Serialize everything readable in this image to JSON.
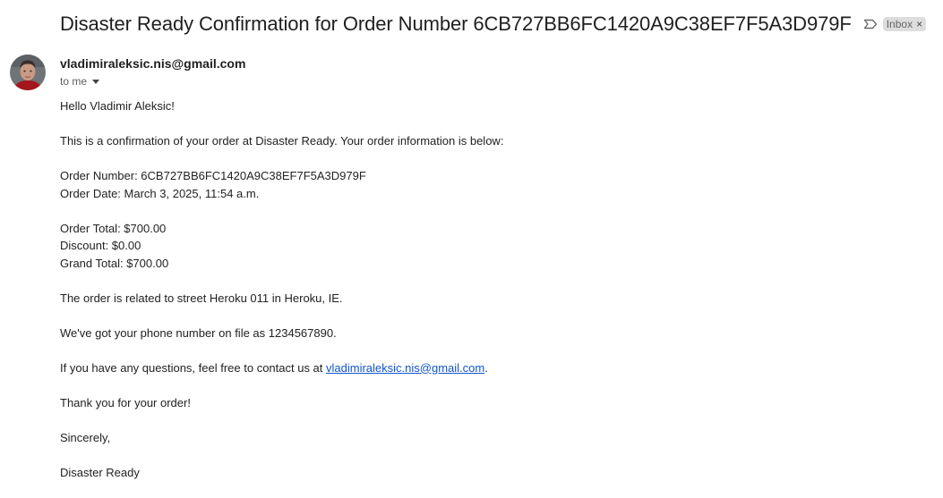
{
  "email": {
    "subject": "Disaster Ready Confirmation for Order Number 6CB727BB6FC1420A9C38EF7F5A3D979F",
    "label": "Inbox",
    "label_close": "×",
    "sender": "vladimiraleksic.nis@gmail.com",
    "recipient": "to me",
    "avatar_icon": "sender-avatar",
    "important_icon": "importance-marker-icon"
  },
  "body": {
    "greeting": "Hello Vladimir Aleksic!",
    "intro": "This is a confirmation of your order at Disaster Ready. Your order information is below:",
    "order_number": "Order Number: 6CB727BB6FC1420A9C38EF7F5A3D979F",
    "order_date": "Order Date: March 3, 2025, 11:54 a.m.",
    "order_total": "Order Total: $700.00",
    "discount": "Discount: $0.00",
    "grand_total": "Grand Total: $700.00",
    "address_line": "The order is related to street Heroku 011 in Heroku, IE.",
    "phone_line": "We've got your phone number on file as 1234567890.",
    "contact_prefix": "If you have any questions, feel free to contact us at ",
    "contact_email": "vladimiraleksic.nis@gmail.com",
    "contact_suffix": ".",
    "thanks": "Thank you for your order!",
    "closing": "Sincerely,",
    "signature": "Disaster Ready"
  },
  "colors": {
    "link": "#1155cc",
    "chip_bg": "#dddddd",
    "avatar_shirt": "#a3161b"
  }
}
